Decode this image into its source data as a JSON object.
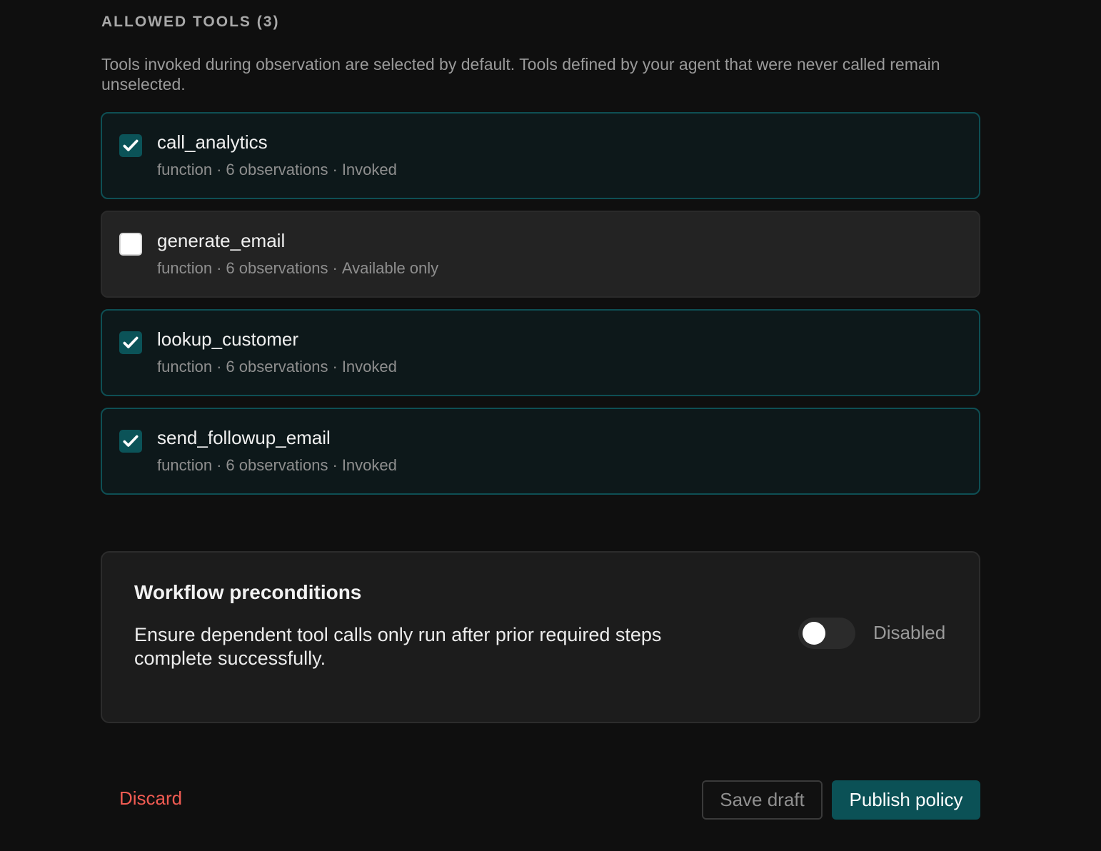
{
  "section": {
    "heading": "ALLOWED TOOLS (3)",
    "description": "Tools invoked during observation are selected by default. Tools defined by your agent that were never called remain unselected."
  },
  "tools": [
    {
      "name": "call_analytics",
      "type": "function",
      "observations": "6 observations",
      "status": "Invoked",
      "checked": true
    },
    {
      "name": "generate_email",
      "type": "function",
      "observations": "6 observations",
      "status": "Available only",
      "checked": false
    },
    {
      "name": "lookup_customer",
      "type": "function",
      "observations": "6 observations",
      "status": "Invoked",
      "checked": true
    },
    {
      "name": "send_followup_email",
      "type": "function",
      "observations": "6 observations",
      "status": "Invoked",
      "checked": true
    }
  ],
  "meta_separator": "·",
  "preconditions": {
    "title": "Workflow preconditions",
    "description": "Ensure dependent tool calls only run after prior required steps complete successfully.",
    "toggle_state": "Disabled"
  },
  "actions": {
    "discard_label": "Discard",
    "save_draft_label": "Save draft",
    "publish_label": "Publish policy"
  },
  "colors": {
    "accent": "#0b5156",
    "danger": "#f05b52",
    "background": "#0f0f0f"
  }
}
